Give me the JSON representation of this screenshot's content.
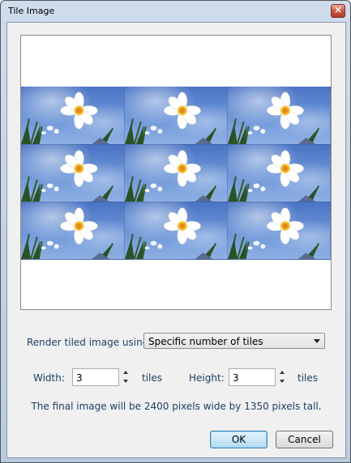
{
  "window": {
    "title": "Tile Image",
    "close_icon": "close-icon"
  },
  "preview": {
    "rows": 3,
    "columns": 3,
    "image_subject": "white daffodil against blue sky"
  },
  "render_label": "Render tiled image using:",
  "render_mode": {
    "selected": "Specific number of tiles"
  },
  "width": {
    "label": "Width:",
    "value": "3",
    "unit": "tiles"
  },
  "height": {
    "label": "Height:",
    "value": "3",
    "unit": "tiles"
  },
  "summary": "The final image will be 2400 pixels wide by 1350 pixels tall.",
  "buttons": {
    "ok": "OK",
    "cancel": "Cancel"
  }
}
